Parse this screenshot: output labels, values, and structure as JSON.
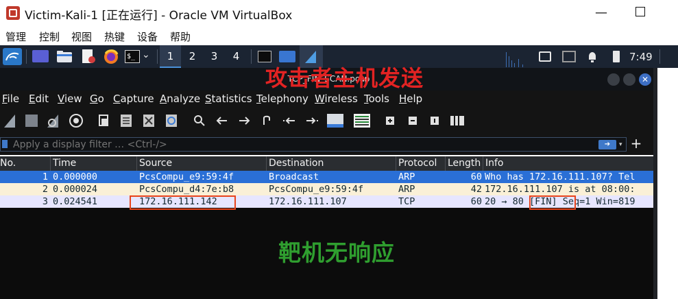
{
  "host_window": {
    "title": "Victim-Kali-1 [正在运行] - Oracle VM VirtualBox",
    "minimize_glyph": "—",
    "menu": [
      "管理",
      "控制",
      "视图",
      "热键",
      "设备",
      "帮助"
    ]
  },
  "kali_panel": {
    "workspaces": [
      "1",
      "2",
      "3",
      "4"
    ],
    "active_workspace": "1",
    "clock": "7:49",
    "terminal_prompt": "$_",
    "dropdown_glyph": "⌄"
  },
  "wireshark": {
    "title": "TCP_FIN_SCAN.pcap",
    "close_glyph": "✕",
    "menu": [
      "File",
      "Edit",
      "View",
      "Go",
      "Capture",
      "Analyze",
      "Statistics",
      "Telephony",
      "Wireless",
      "Tools",
      "Help"
    ],
    "filter": {
      "placeholder": "Apply a display filter … <Ctrl-/>",
      "value": "",
      "add_glyph": "+"
    },
    "columns": [
      "No.",
      "Time",
      "Source",
      "Destination",
      "Protocol",
      "Length",
      "Info"
    ],
    "packets": [
      {
        "no": "1",
        "time": "0.000000",
        "source": "PcsCompu_e9:59:4f",
        "destination": "Broadcast",
        "protocol": "ARP",
        "length": "60",
        "info": "Who has 172.16.111.107? Tel",
        "bg": "#2a6fd6",
        "fg": "#ffffff"
      },
      {
        "no": "2",
        "time": "0.000024",
        "source": "PcsCompu_d4:7e:b8",
        "destination": "PcsCompu_e9:59:4f",
        "protocol": "ARP",
        "length": "42",
        "info": "172.16.111.107 is at 08:00:",
        "bg": "#faf0d7",
        "fg": "#12272e"
      },
      {
        "no": "3",
        "time": "0.024541",
        "source": "172.16.111.142",
        "destination": "172.16.111.107",
        "protocol": "TCP",
        "length": "60",
        "info": "20 → 80 [FIN] Seq=1 Win=819",
        "bg": "#e7e6ff",
        "fg": "#12272e"
      }
    ]
  },
  "annotations": {
    "attacker_sends": "攻击者主机发送",
    "target_no_response": "靶机无响应",
    "attacker_color": "#e22323",
    "target_color": "#2f9e2f",
    "box_color": "#e8431b"
  }
}
